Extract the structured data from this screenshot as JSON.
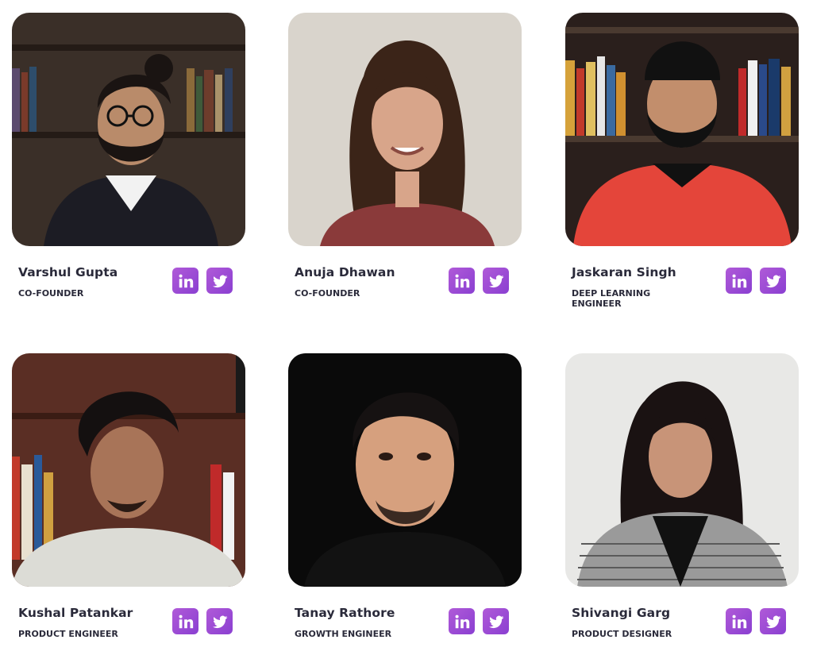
{
  "team": [
    {
      "name": "Varshul Gupta",
      "role": "CO-FOUNDER",
      "photo": {
        "bg": "#3a2f28",
        "shirt": "#1c1c24",
        "skin": "#b98b6a",
        "hair": "#1a1412",
        "description_icon": "person-photo"
      }
    },
    {
      "name": "Anuja Dhawan",
      "role": "CO-FOUNDER",
      "photo": {
        "bg": "#d9d4cc",
        "shirt": "#8a3a3a",
        "skin": "#d8a58a",
        "hair": "#3b2418",
        "description_icon": "person-photo"
      }
    },
    {
      "name": "Jaskaran Singh",
      "role": "DEEP LEARNING ENGINEER",
      "photo": {
        "bg": "#2a1f1c",
        "shirt": "#e4453a",
        "skin": "#c28e6c",
        "hair": "#111111",
        "description_icon": "person-photo"
      }
    },
    {
      "name": "Kushal Patankar",
      "role": "PRODUCT ENGINEER",
      "photo": {
        "bg": "#5a2e24",
        "shirt": "#dcdcd6",
        "skin": "#a87458",
        "hair": "#141010",
        "description_icon": "person-photo"
      }
    },
    {
      "name": "Tanay Rathore",
      "role": "GROWTH ENGINEER",
      "photo": {
        "bg": "#0a0a0a",
        "shirt": "#121212",
        "skin": "#d6a07e",
        "hair": "#161212",
        "description_icon": "person-photo"
      }
    },
    {
      "name": "Shivangi Garg",
      "role": "PRODUCT DESIGNER",
      "photo": {
        "bg": "#e8e8e6",
        "shirt": "#9a9a9a",
        "skin": "#c89478",
        "hair": "#1a1212",
        "description_icon": "person-photo"
      }
    }
  ],
  "socials": {
    "linkedin_icon": "linkedin-icon",
    "twitter_icon": "twitter-icon",
    "accent": "#9b4dd4"
  }
}
